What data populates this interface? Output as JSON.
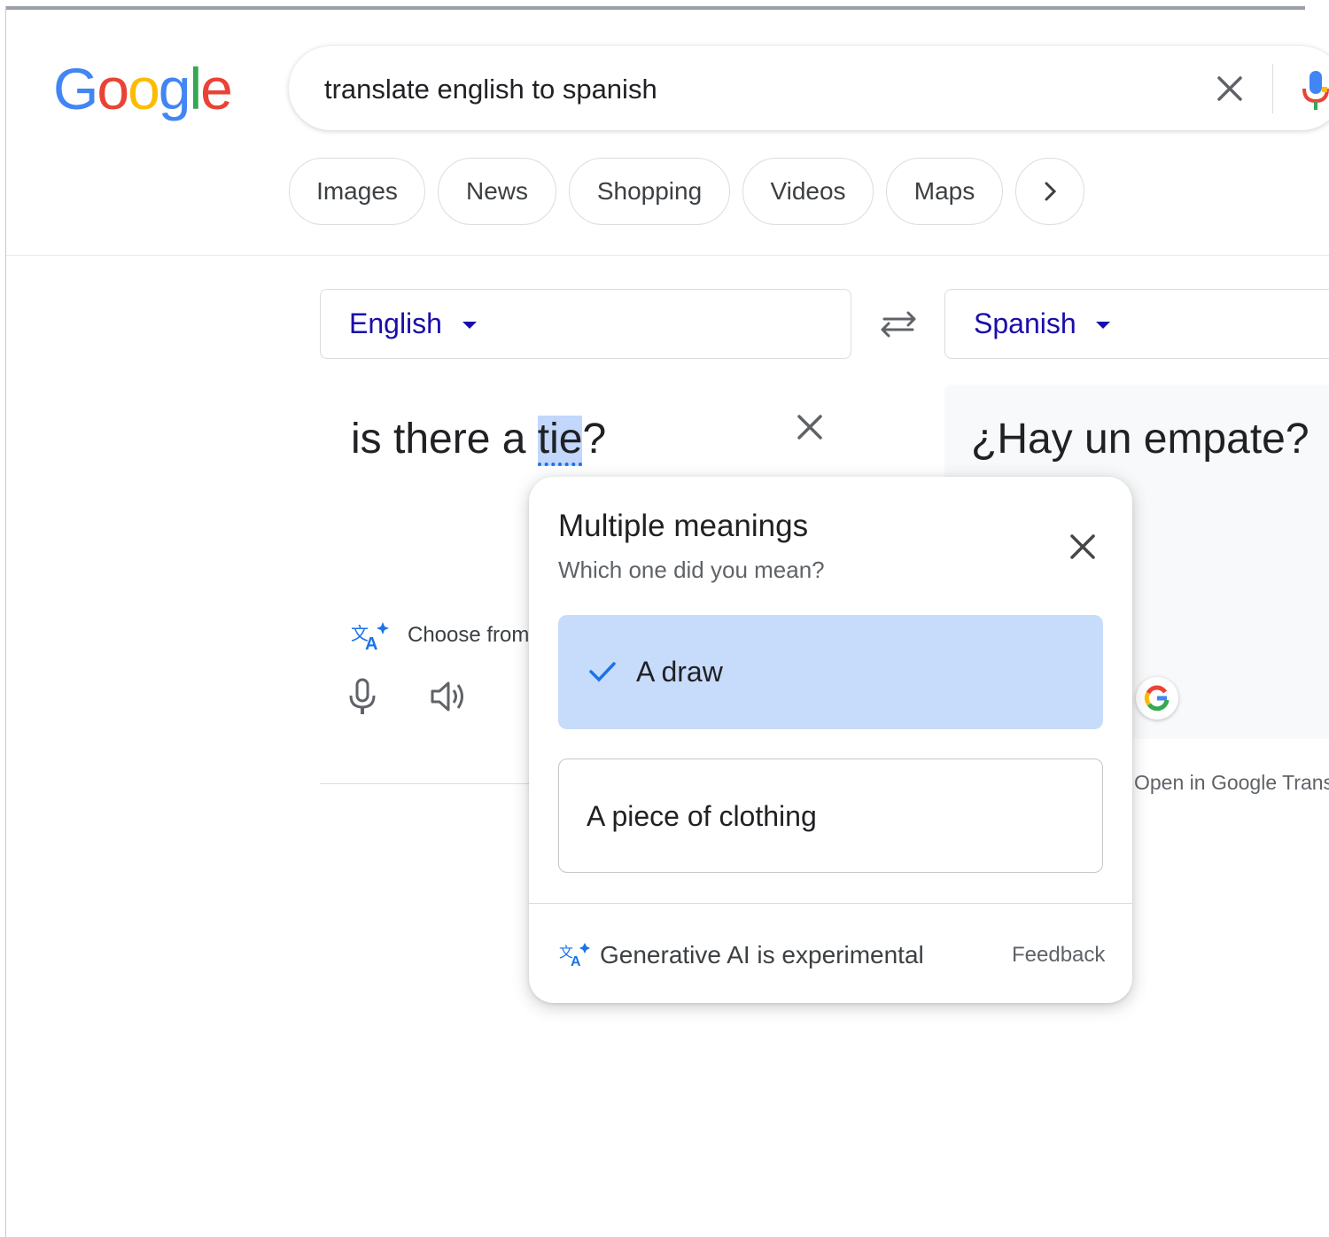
{
  "logo": {
    "letters": [
      "G",
      "o",
      "o",
      "g",
      "l",
      "e"
    ],
    "colors": [
      "#4285F4",
      "#EA4335",
      "#FBBC05",
      "#4285F4",
      "#34A853",
      "#EA4335"
    ]
  },
  "search": {
    "query": "translate english to spanish"
  },
  "chips": [
    "Images",
    "News",
    "Shopping",
    "Videos",
    "Maps"
  ],
  "translator": {
    "source_lang": "English",
    "target_lang": "Spanish",
    "source_text_before": "is there a ",
    "source_highlight": "tie",
    "source_text_after": "?",
    "target_text": "¿Hay un empate?",
    "choose_from": "Choose from",
    "open_in_translate": "Open in Google Translate"
  },
  "popup": {
    "title": "Multiple meanings",
    "subtitle": "Which one did you mean?",
    "options": [
      {
        "label": "A draw",
        "selected": true
      },
      {
        "label": "A piece of clothing",
        "selected": false
      }
    ],
    "footer_text": "Generative AI is experimental",
    "feedback": "Feedback"
  },
  "colors": {
    "link_blue": "#1a0dab",
    "accent_blue": "#1a73e8",
    "selected_bg": "#c7dbfb"
  }
}
